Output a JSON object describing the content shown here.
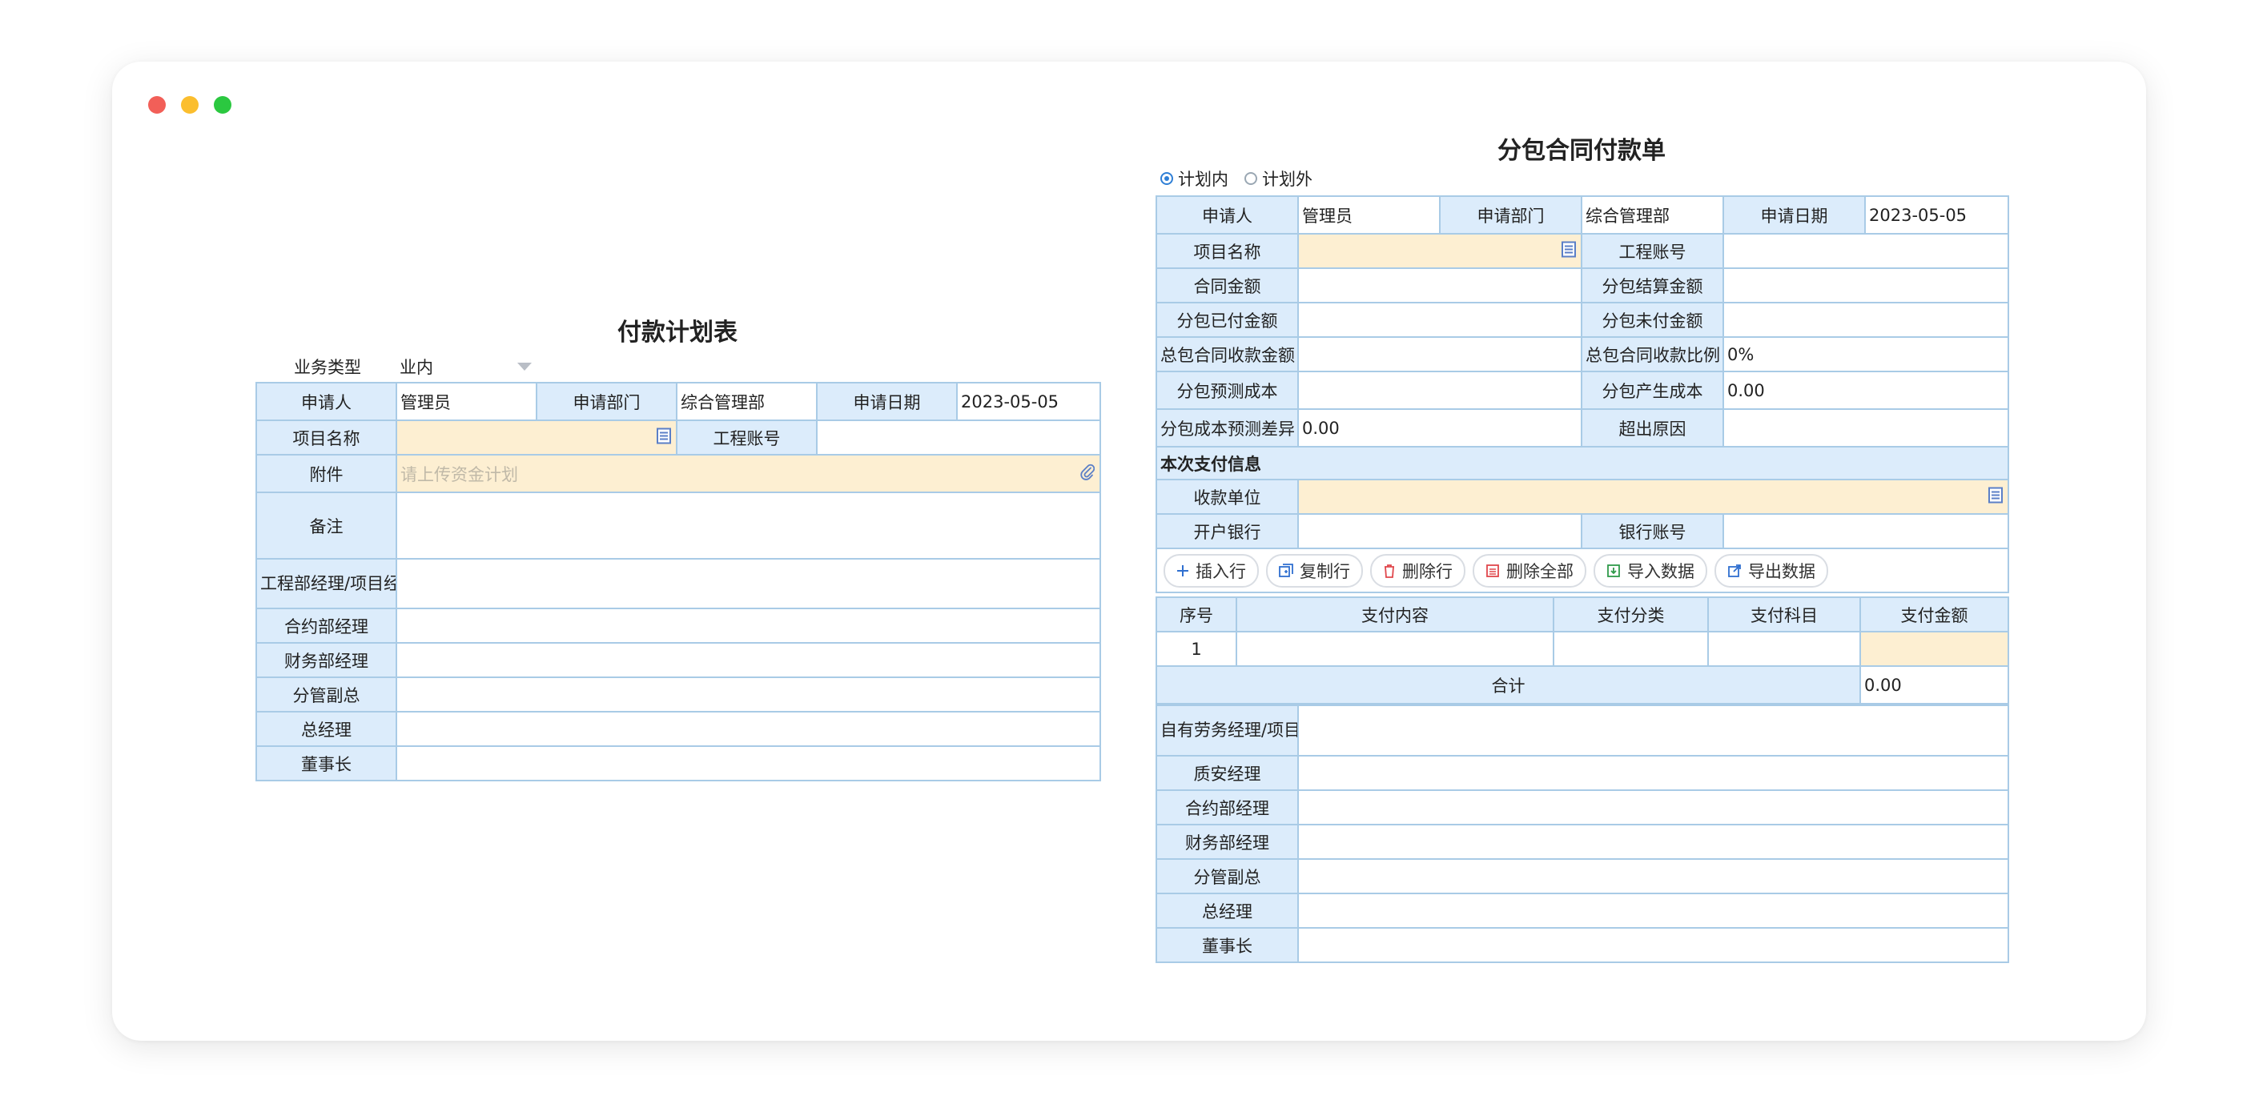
{
  "left_form": {
    "title": "付款计划表",
    "business_type_label": "业务类型",
    "business_type_value": "业内",
    "applicant_label": "申请人",
    "applicant_value": "管理员",
    "dept_label": "申请部门",
    "dept_value": "综合管理部",
    "date_label": "申请日期",
    "date_value": "2023-05-05",
    "project_label": "项目名称",
    "project_value": "",
    "account_label": "工程账号",
    "account_value": "",
    "attachment_label": "附件",
    "attachment_placeholder": "请上传资金计划",
    "remark_label": "备注",
    "approvals": [
      "工程部经理/项目经理",
      "合约部经理",
      "财务部经理",
      "分管副总",
      "总经理",
      "董事长"
    ]
  },
  "right_form": {
    "title": "分包合同付款单",
    "radio_options": [
      {
        "label": "计划内",
        "checked": true
      },
      {
        "label": "计划外",
        "checked": false
      }
    ],
    "applicant_label": "申请人",
    "applicant_value": "管理员",
    "dept_label": "申请部门",
    "dept_value": "综合管理部",
    "date_label": "申请日期",
    "date_value": "2023-05-05",
    "rows": [
      {
        "l1": "项目名称",
        "v1": "",
        "l2": "工程账号",
        "v2": ""
      },
      {
        "l1": "合同金额",
        "v1": "",
        "l2": "分包结算金额",
        "v2": ""
      },
      {
        "l1": "分包已付金额",
        "v1": "",
        "l2": "分包未付金额",
        "v2": ""
      },
      {
        "l1": "总包合同收款金额",
        "v1": "",
        "l2": "总包合同收款比例",
        "v2": "0%"
      },
      {
        "l1": "分包预测成本",
        "v1": "",
        "l2": "分包产生成本",
        "v2": "0.00"
      },
      {
        "l1": "分包成本预测差异",
        "v1": "0.00",
        "l2": "超出原因",
        "v2": ""
      }
    ],
    "payment_section_title": "本次支付信息",
    "payee_label": "收款单位",
    "payee_value": "",
    "bank_label": "开户银行",
    "bank_value": "",
    "bank_account_label": "银行账号",
    "bank_account_value": "",
    "toolbar": {
      "insert": "插入行",
      "copy": "复制行",
      "delete": "删除行",
      "delete_all": "删除全部",
      "import": "导入数据",
      "export": "导出数据"
    },
    "detail_table": {
      "headers": [
        "序号",
        "支付内容",
        "支付分类",
        "支付科目",
        "支付金额"
      ],
      "rows": [
        {
          "index": "1",
          "content": "",
          "category": "",
          "subject": "",
          "amount": ""
        }
      ],
      "total_label": "合计",
      "total_value": "0.00"
    },
    "approvals": [
      "自有劳务经理/项目经理",
      "质安经理",
      "合约部经理",
      "财务部经理",
      "分管副总",
      "总经理",
      "董事长"
    ]
  }
}
